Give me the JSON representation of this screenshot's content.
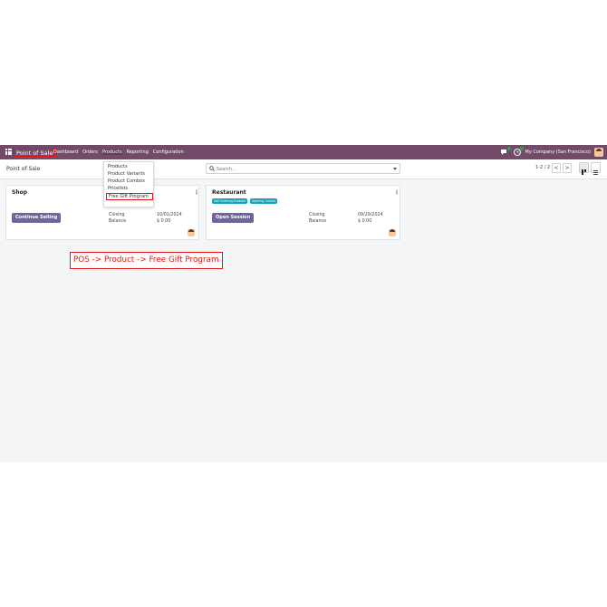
{
  "navbar": {
    "app_name": "Point of Sale",
    "menu": [
      "Dashboard",
      "Orders",
      "Products",
      "Reporting",
      "Configuration"
    ],
    "company": "My Company (San Francisco)"
  },
  "breadcrumb": "Point of Sale",
  "search": {
    "placeholder": "Search..."
  },
  "pager": {
    "text": "1-2 / 2",
    "prev": "<",
    "next": ">"
  },
  "products_menu": {
    "items": [
      "Products",
      "Product Variants",
      "Product Combos",
      "Pricelists",
      "Free Gift Program"
    ],
    "highlighted": "Free Gift Program"
  },
  "cards": [
    {
      "name": "Shop",
      "action": "Continue Selling",
      "closing_label": "Closing",
      "closing_value": "10/01/2024",
      "balance_label": "Balance",
      "balance_value": "$ 0.00",
      "badges": []
    },
    {
      "name": "Restaurant",
      "action": "Open Session",
      "closing_label": "Closing",
      "closing_value": "09/29/2024",
      "balance_label": "Balance",
      "balance_value": "$ 0.00",
      "badges": [
        "Self Ordering Enabled",
        "Opening Control"
      ]
    }
  ],
  "annotation": "POS -> Product -> Free Gift Program",
  "colors": {
    "navbar": "#714b67",
    "primary_button": "#71639e",
    "badge": "#17a2b8",
    "highlight": "#e11111",
    "notification_dot": "#28a745"
  },
  "icons": [
    "apps-grid-icon",
    "chat-icon",
    "activity-clock-icon",
    "search-icon",
    "kanban-view-icon",
    "list-view-icon",
    "kebab-menu-icon"
  ]
}
